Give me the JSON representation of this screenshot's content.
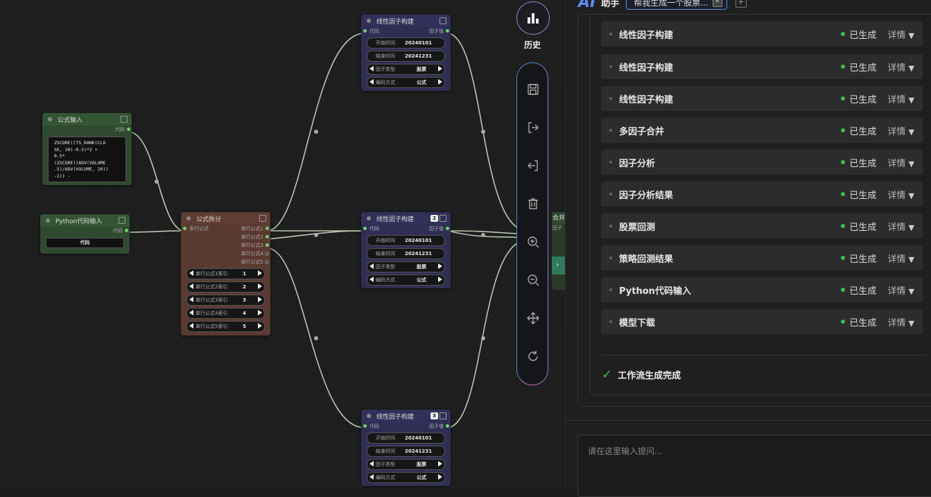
{
  "nodes": {
    "formula_input": {
      "title": "公式输入",
      "out_label": "代码",
      "code": "ZSCORE((TS_RANK(CLO\nSE, 20)-0.5)*2 +\n0.5*\n(ZSCORE((ADV(VOLUME\n.5)/ADV(VOLUME, 20))\n-1)) -"
    },
    "python_input": {
      "title": "Python代码输入",
      "out_label": "代码",
      "button": "代码"
    },
    "formula_split": {
      "title": "公式拆分",
      "in_label": "多行公式",
      "outputs": [
        "单行公式1",
        "单行公式2",
        "单行公式3",
        "单行公式4",
        "单行公式5"
      ],
      "widgets": [
        {
          "label": "单行公式1索引",
          "value": "1"
        },
        {
          "label": "单行公式2索引",
          "value": "2"
        },
        {
          "label": "单行公式3索引",
          "value": "3"
        },
        {
          "label": "单行公式4索引",
          "value": "4"
        },
        {
          "label": "单行公式5索引",
          "value": "5"
        }
      ]
    },
    "linear": [
      {
        "title": "线性因子构建",
        "badge": "",
        "in_label": "代码",
        "out_label": "因子值",
        "start_label": "开始时间",
        "start": "20240101",
        "end_label": "结束时间",
        "end": "20241231",
        "type_label": "因子类型",
        "type": "股票",
        "enc_label": "编码方式",
        "enc": "公式"
      },
      {
        "title": "线性因子构建",
        "badge": "2",
        "in_label": "代码",
        "out_label": "因子值",
        "start_label": "开始时间",
        "start": "20240101",
        "end_label": "结束时间",
        "end": "20241231",
        "type_label": "因子类型",
        "type": "股票",
        "enc_label": "编码方式",
        "enc": "公式"
      },
      {
        "title": "线性因子构建",
        "badge": "3",
        "in_label": "代码",
        "out_label": "因子值",
        "start_label": "开始时间",
        "start": "20240101",
        "end_label": "结束时间",
        "end": "20241231",
        "type_label": "因子类型",
        "type": "股票",
        "enc_label": "编码方式",
        "enc": "公式"
      }
    ],
    "partial_merge": {
      "title": "合并",
      "out_label": "因子"
    }
  },
  "toolbar": {
    "history_label": "历史",
    "icons": [
      "save-icon",
      "export-icon",
      "import-icon",
      "trash-icon",
      "zoom-in-icon",
      "zoom-out-icon",
      "move-icon",
      "refresh-icon"
    ]
  },
  "panel": {
    "logo": "AI",
    "title": "助手",
    "session_tab": "帮我生成一个股票...",
    "steps": [
      {
        "name": "线性因子构建",
        "status": "已生成",
        "detail": "详情"
      },
      {
        "name": "线性因子构建",
        "status": "已生成",
        "detail": "详情"
      },
      {
        "name": "线性因子构建",
        "status": "已生成",
        "detail": "详情"
      },
      {
        "name": "多因子合并",
        "status": "已生成",
        "detail": "详情"
      },
      {
        "name": "因子分析",
        "status": "已生成",
        "detail": "详情"
      },
      {
        "name": "因子分析结果",
        "status": "已生成",
        "detail": "详情"
      },
      {
        "name": "股票回测",
        "status": "已生成",
        "detail": "详情"
      },
      {
        "name": "策略回测结果",
        "status": "已生成",
        "detail": "详情"
      },
      {
        "name": "Python代码输入",
        "status": "已生成",
        "detail": "详情"
      },
      {
        "name": "模型下载",
        "status": "已生成",
        "detail": "详情"
      }
    ],
    "done_text": "工作流生成完成",
    "prompt_placeholder": "请在这里输入提问..."
  },
  "colors": {
    "accent": "#5a8ef0",
    "success": "#3cbf4a",
    "node_green": "#2f4a2f",
    "node_brown": "#5a3a30",
    "node_purple": "#2e2e55"
  }
}
